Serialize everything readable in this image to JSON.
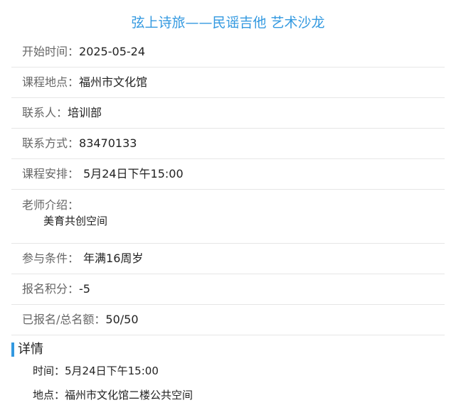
{
  "title": "弦上诗旅——民谣吉他 艺术沙龙",
  "info_rows": [
    {
      "label": "开始时间：",
      "value": "2025-05-24"
    },
    {
      "label": "课程地点：",
      "value": "福州市文化馆"
    },
    {
      "label": "联系人：",
      "value": "培训部"
    },
    {
      "label": "联系方式：",
      "value": "83470133"
    },
    {
      "label": "课程安排：",
      "value": "5月24日下午15:00"
    },
    {
      "label": "老师介绍：",
      "value": "美育共创空间"
    },
    {
      "label": "参与条件：",
      "value": "年满16周岁"
    },
    {
      "label": "报名积分：",
      "value": "-5"
    },
    {
      "label": "已报名/总名额：",
      "value": "50/50"
    }
  ],
  "details": {
    "heading": "详情",
    "lines": [
      "时间：5月24日下午15:00",
      "地点：福州市文化馆二楼公共空间"
    ]
  },
  "colors": {
    "accent": "#3399e0",
    "label": "#666666",
    "value": "#222222",
    "divider": "#e6e6e6"
  }
}
